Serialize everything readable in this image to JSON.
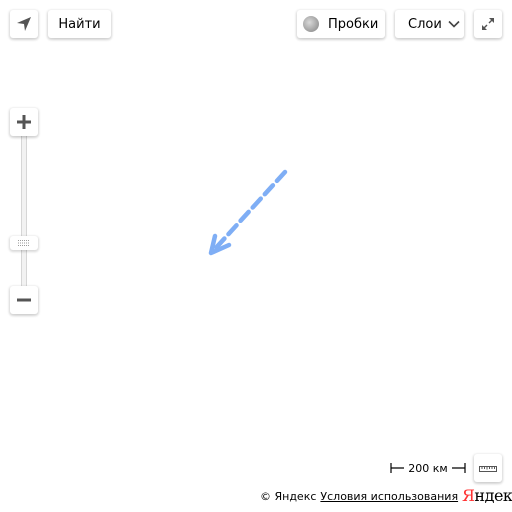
{
  "controls": {
    "search_label": "Найти",
    "traffic_label": "Пробки",
    "layers_label": "Слои"
  },
  "icons": {
    "geolocation": "arrow-navigation-icon",
    "fullscreen": "expand-icon",
    "zoom_in": "plus-icon",
    "zoom_out": "minus-icon",
    "ruler": "ruler-icon",
    "layers_dropdown": "chevron-down-icon",
    "traffic": "traffic-indicator-icon"
  },
  "scale": {
    "label": "200 км"
  },
  "footer": {
    "copyright": "© Яндекс",
    "terms_link": "Условия использования"
  },
  "logo": {
    "text_first": "Я",
    "text_rest": "ндекс"
  },
  "route": {
    "color": "#7faef5",
    "style": "dashed-arrow"
  }
}
